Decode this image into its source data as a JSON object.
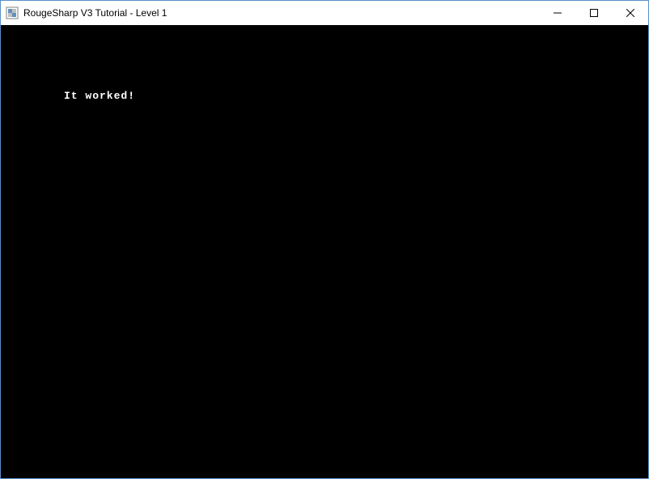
{
  "window": {
    "title": "RougeSharp V3 Tutorial - Level 1"
  },
  "content": {
    "message": "It worked!"
  }
}
